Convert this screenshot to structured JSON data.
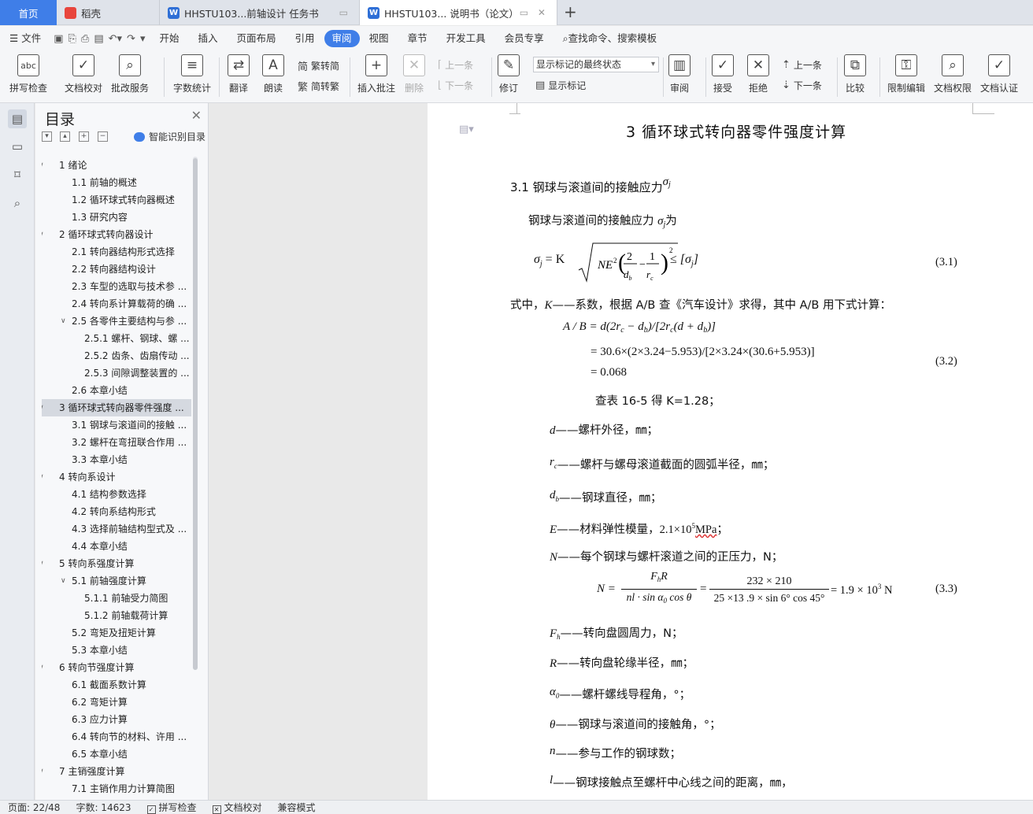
{
  "tabs": {
    "home": "首页",
    "t1": "稻壳",
    "t2": "HHSTU103...前轴设计 任务书",
    "t3": "HHSTU103... 说明书（论文）"
  },
  "menu": {
    "file": "文件",
    "items": [
      "开始",
      "插入",
      "页面布局",
      "引用",
      "审阅",
      "视图",
      "章节",
      "开发工具",
      "会员专享"
    ],
    "active": "审阅",
    "search": "查找命令、搜索模板"
  },
  "ribbon": {
    "spell": "拼写检查",
    "spell_icon": "abc",
    "doc_check": "文档校对",
    "batch": "批改服务",
    "wordcount": "字数统计",
    "translate": "翻译",
    "read": "朗读",
    "trad": "繁转简",
    "simp": "简转繁",
    "insert_comment": "插入批注",
    "delete": "删除",
    "prev1": "上一条",
    "next1": "下一条",
    "revise": "修订",
    "display_state": "显示标记的最终状态",
    "show_marks": "显示标记",
    "review": "审阅",
    "accept": "接受",
    "reject": "拒绝",
    "prev2": "上一条",
    "next2": "下一条",
    "compare": "比较",
    "restrict": "限制编辑",
    "perm": "文档权限",
    "cert": "文档认证"
  },
  "toc": {
    "title": "目录",
    "smart": "智能识别目录",
    "items": [
      {
        "t": "1  绪论",
        "l": 1,
        "a": "v"
      },
      {
        "t": "1.1 前轴的概述",
        "l": 2,
        "a": ""
      },
      {
        "t": "1.2  循环球式转向器概述",
        "l": 2,
        "a": ""
      },
      {
        "t": "1.3  研究内容",
        "l": 2,
        "a": ""
      },
      {
        "t": "2  循环球式转向器设计",
        "l": 1,
        "a": "v"
      },
      {
        "t": "2.1  转向器结构形式选择",
        "l": 2,
        "a": ""
      },
      {
        "t": "2.2  转向器结构设计",
        "l": 2,
        "a": ""
      },
      {
        "t": "2.3 车型的选取与技术参 ...",
        "l": 2,
        "a": ""
      },
      {
        "t": "2.4  转向系计算载荷的确 ...",
        "l": 2,
        "a": ""
      },
      {
        "t": "2.5 各零件主要结构与参 ...",
        "l": 2,
        "a": "v"
      },
      {
        "t": "2.5.1  螺杆、钢球、螺 ...",
        "l": 3,
        "a": ""
      },
      {
        "t": "2.5.2  齿条、齿扇传动 ...",
        "l": 3,
        "a": ""
      },
      {
        "t": "2.5.3  间隙调整装置的 ...",
        "l": 3,
        "a": ""
      },
      {
        "t": "2.6  本章小结",
        "l": 2,
        "a": ""
      },
      {
        "t": "3  循环球式转向器零件强度 ...",
        "l": 1,
        "a": "v",
        "sel": true
      },
      {
        "t": "3.1  钢球与滚道间的接触 ...",
        "l": 2,
        "a": ""
      },
      {
        "t": "3.2  螺杆在弯扭联合作用 ...",
        "l": 2,
        "a": ""
      },
      {
        "t": "3.3  本章小结",
        "l": 2,
        "a": ""
      },
      {
        "t": "4  转向系设计",
        "l": 1,
        "a": "v"
      },
      {
        "t": "4.1  结构参数选择",
        "l": 2,
        "a": ""
      },
      {
        "t": "4.2  转向系结构形式",
        "l": 2,
        "a": ""
      },
      {
        "t": "4.3  选择前轴结构型式及 ...",
        "l": 2,
        "a": ""
      },
      {
        "t": "4.4  本章小结",
        "l": 2,
        "a": ""
      },
      {
        "t": "5  转向系强度计算",
        "l": 1,
        "a": "v"
      },
      {
        "t": "5.1  前轴强度计算",
        "l": 2,
        "a": "v"
      },
      {
        "t": "5.1.1  前轴受力简图",
        "l": 3,
        "a": ""
      },
      {
        "t": "5.1.2  前轴载荷计算",
        "l": 3,
        "a": ""
      },
      {
        "t": "5.2  弯矩及扭矩计算",
        "l": 2,
        "a": ""
      },
      {
        "t": "5.3  本章小结",
        "l": 2,
        "a": ""
      },
      {
        "t": "6  转向节强度计算",
        "l": 1,
        "a": "v"
      },
      {
        "t": "6.1  截面系数计算",
        "l": 2,
        "a": ""
      },
      {
        "t": "6.2  弯矩计算",
        "l": 2,
        "a": ""
      },
      {
        "t": "6.3  应力计算",
        "l": 2,
        "a": ""
      },
      {
        "t": "6.4  转向节的材料、许用 ...",
        "l": 2,
        "a": ""
      },
      {
        "t": "6.5  本章小结",
        "l": 2,
        "a": ""
      },
      {
        "t": "7  主销强度计算",
        "l": 1,
        "a": "v"
      },
      {
        "t": "7.1  主销作用力计算简图",
        "l": 2,
        "a": ""
      }
    ]
  },
  "doc": {
    "chapter": "3  循环球式转向器零件强度计算",
    "sec": "3.1  钢球与滚道间的接触应力",
    "sigma_j": "σ",
    "sub_j": "j",
    "intro": "钢球与滚道间的接触应力",
    "intro_end": "为",
    "eq1_lhs": "σ",
    "eq1_mid": "= K",
    "eq1_root": "NE",
    "eq1_le": "≤",
    "eq1_rhs": "[σ",
    "eq1_rhs_end": "]",
    "eq1_no": "(3.1)",
    "where": "式中，",
    "K": "K",
    "k_desc": "——系数，根据 A/B 查《汽车设计》求得，其中 A/B 用下式计算：",
    "eq2_l1": "A / B = d(2r",
    "eq2_l1b": " − d",
    "eq2_l1c": ")/[2r",
    "eq2_l1d": "(d + d",
    "eq2_l1e": ")]",
    "eq2_l2": "= 30.6×(2×3.24−5.953)/[2×3.24×(30.6+5.953)]",
    "eq2_l3": "= 0.068",
    "eq2_no": "(3.2)",
    "table": "查表 16-5 得 K=1.28；",
    "d": "d",
    "d_desc": "——螺杆外径，㎜；",
    "rc": "r",
    "rc_sub": "c",
    "rc_desc": "——螺杆与螺母滚道截面的圆弧半径，㎜；",
    "db": "d",
    "db_sub": "b",
    "db_desc": "——钢球直径，㎜；",
    "E": "E",
    "E_desc": "——材料弹性模量，",
    "E_val": "2.1×10",
    "E_exp": "5",
    "E_unit": "MPa",
    "E_end": "；",
    "N": "N",
    "N_desc": "——每个钢球与螺杆滚道之间的正压力，N；",
    "eq3_lhs": "N =",
    "eq3_num1": "F",
    "eq3_num1b": "R",
    "eq3_den1": "nl · sin α",
    "eq3_den1b": " cos θ",
    "eq3_num2": "232 × 210",
    "eq3_den2": "25 ×13 .9 × sin 6° cos 45°",
    "eq3_res": "= 1.9 × 10",
    "eq3_exp": "3",
    "eq3_unit": " N",
    "eq3_no": "(3.3)",
    "Fh": "F",
    "Fh_sub": "h",
    "Fh_desc": "——转向盘圆周力，N；",
    "R": "R",
    "R_desc": "——转向盘轮缘半径，㎜；",
    "a0": "α",
    "a0_sub": "0",
    "a0_desc": "——螺杆螺线导程角，°；",
    "theta": "θ",
    "theta_desc": "——钢球与滚道间的接触角，°；",
    "n": "n",
    "n_desc": "——参与工作的钢球数；",
    "l": "l",
    "l_desc": "——钢球接触点至螺杆中心线之间的距离，㎜，"
  },
  "status": {
    "page": "页面: 22/48",
    "words": "字数: 14623",
    "spell": "拼写检查",
    "check": "文档校对",
    "compat": "兼容模式"
  }
}
